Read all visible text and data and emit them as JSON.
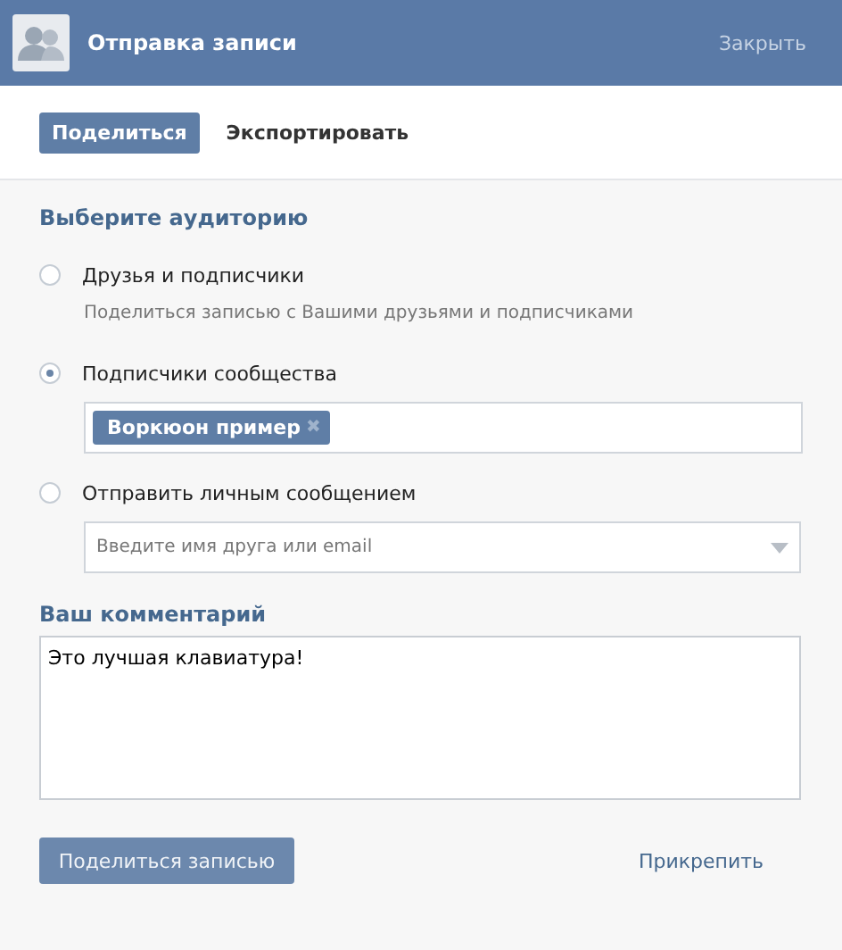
{
  "window": {
    "title": "Отправка записи",
    "close": "Закрыть"
  },
  "tabs": [
    {
      "label": "Поделиться",
      "selected": true
    },
    {
      "label": "Экспортировать",
      "selected": false
    }
  ],
  "audience": {
    "title": "Выберите аудиторию",
    "options": [
      {
        "label": "Друзья и подписчики",
        "selected": false,
        "kind": "description",
        "description": "Поделиться записью с Вашими друзьями и подписчиками"
      },
      {
        "label": "Подписчики сообщества",
        "selected": true,
        "kind": "tokens",
        "tokens": [
          {
            "label": "Воркюон пример",
            "remove": "✖"
          }
        ]
      },
      {
        "label": "Отправить личным сообщением",
        "selected": false,
        "kind": "select",
        "placeholder": "Введите имя друга или email"
      }
    ]
  },
  "comment": {
    "title": "Ваш комментарий",
    "value": "Это лучшая клавиатура!"
  },
  "submit": "Поделиться записью",
  "attach": "Прикрепить"
}
